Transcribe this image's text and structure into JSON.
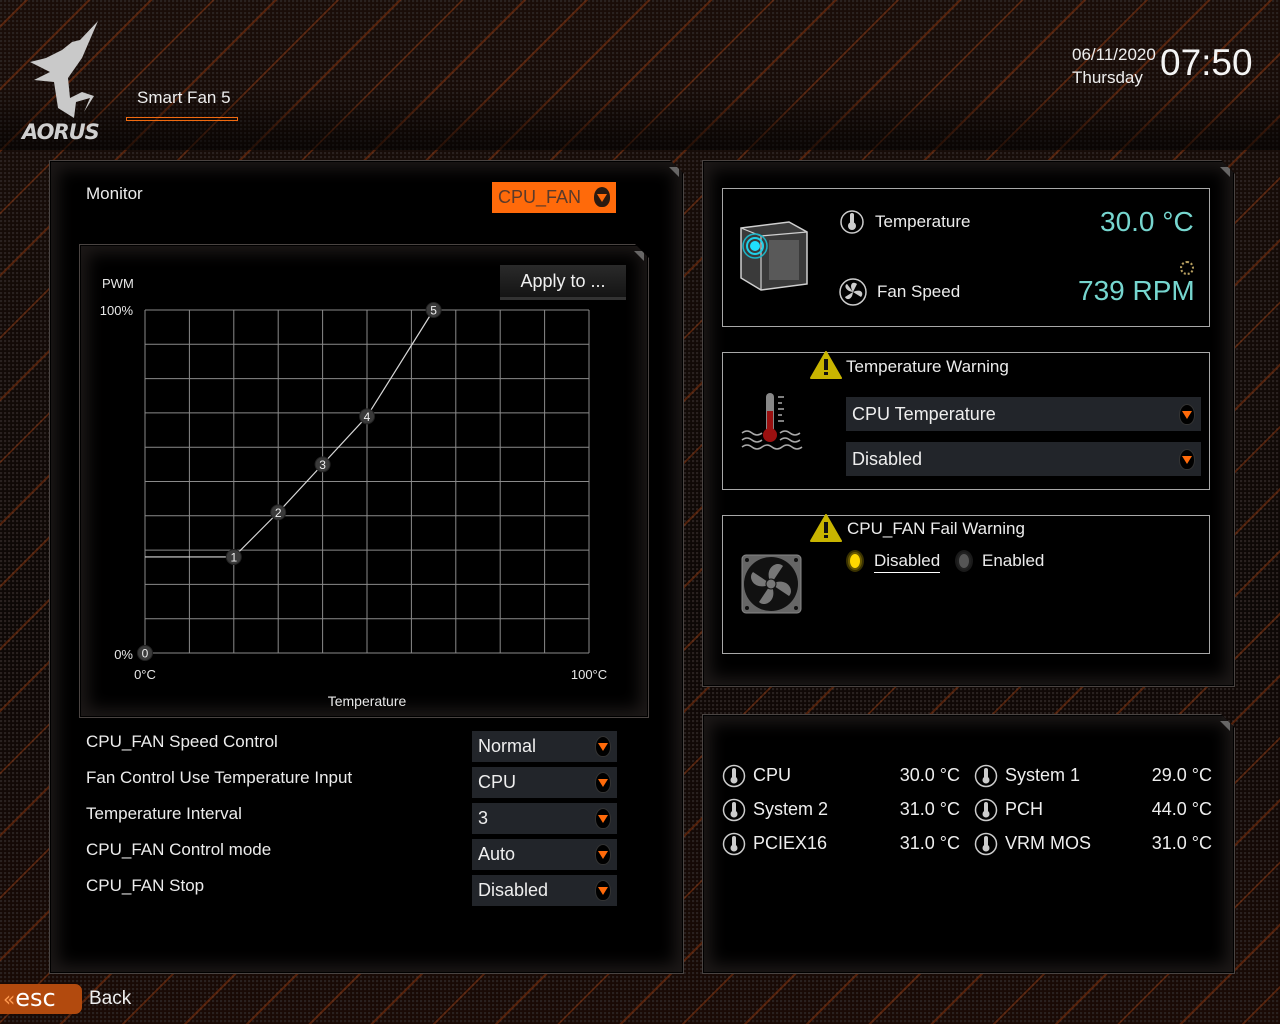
{
  "header": {
    "brand": "AORUS",
    "tab_title": "Smart Fan 5",
    "date": "06/11/2020",
    "weekday": "Thursday",
    "time": "07:50"
  },
  "left_panel": {
    "monitor_label": "Monitor",
    "monitor_select": "CPU_FAN",
    "apply_button": "Apply to ..."
  },
  "chart_data": {
    "type": "line",
    "title": "",
    "xlabel": "Temperature",
    "ylabel": "PWM",
    "x_unit": "°C",
    "y_unit": "%",
    "xlim": [
      0,
      100
    ],
    "ylim": [
      0,
      100
    ],
    "x_tick_labels": [
      "0°C",
      "100°C"
    ],
    "y_tick_labels": [
      "0%",
      "100%"
    ],
    "grid": true,
    "grid_divisions": 10,
    "baseline_pwm": 28,
    "points": [
      {
        "label": "0",
        "x": 0,
        "y": 0
      },
      {
        "label": "1",
        "x": 20,
        "y": 28
      },
      {
        "label": "2",
        "x": 30,
        "y": 41
      },
      {
        "label": "3",
        "x": 40,
        "y": 55
      },
      {
        "label": "4",
        "x": 50,
        "y": 69
      },
      {
        "label": "5",
        "x": 65,
        "y": 100
      }
    ]
  },
  "settings": [
    {
      "label": "CPU_FAN Speed Control",
      "value": "Normal"
    },
    {
      "label": "Fan Control Use Temperature Input",
      "value": "CPU"
    },
    {
      "label": "Temperature Interval",
      "value": "3"
    },
    {
      "label": "CPU_FAN Control mode",
      "value": "Auto"
    },
    {
      "label": "CPU_FAN Stop",
      "value": "Disabled"
    }
  ],
  "status": {
    "temperature_label": "Temperature",
    "temperature_value": "30.0 °C",
    "fan_speed_label": "Fan Speed",
    "fan_speed_value": "739 RPM"
  },
  "temp_warning": {
    "title": "Temperature Warning",
    "source": "CPU Temperature",
    "threshold": "Disabled"
  },
  "fail_warning": {
    "title": "CPU_FAN Fail Warning",
    "options": [
      "Disabled",
      "Enabled"
    ],
    "selected": "Disabled"
  },
  "sensors": [
    {
      "name": "CPU",
      "value": "30.0 °C"
    },
    {
      "name": "System 1",
      "value": "29.0 °C"
    },
    {
      "name": "System 2",
      "value": "31.0 °C"
    },
    {
      "name": "PCH",
      "value": "44.0 °C"
    },
    {
      "name": "PCIEX16",
      "value": "31.0 °C"
    },
    {
      "name": "VRM MOS",
      "value": "31.0 °C"
    }
  ],
  "footer": {
    "esc_label": "esc",
    "back_label": "Back"
  },
  "colors": {
    "accent": "#ff6a0a",
    "value_cyan": "#76d6cf",
    "warning_yellow": "#c8b400"
  }
}
